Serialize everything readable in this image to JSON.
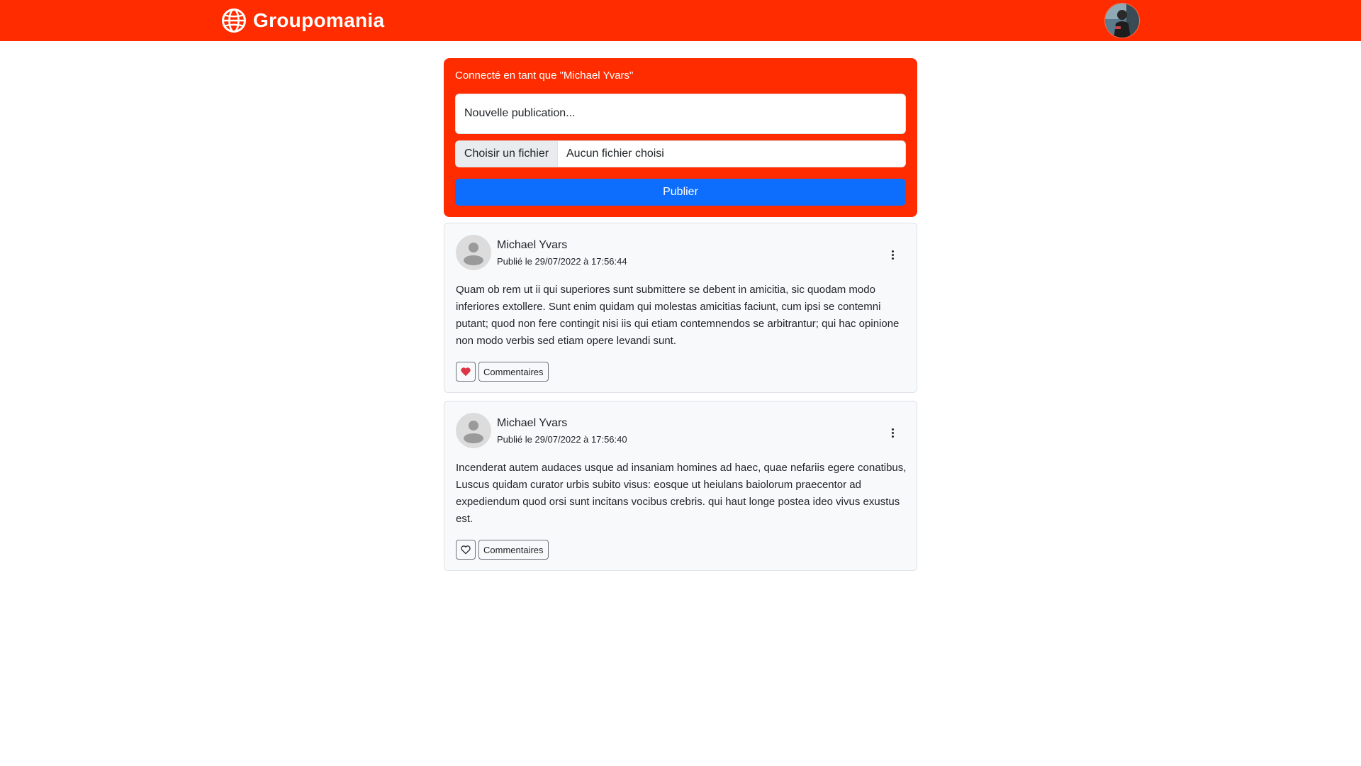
{
  "header": {
    "brand_name": "Groupomania",
    "brand_icon": "globe-icon",
    "color": "#ff2c00"
  },
  "composer": {
    "connected_label": "Connecté en tant que \"Michael Yvars\"",
    "textarea_placeholder": "Nouvelle publication...",
    "file_button_label": "Choisir un fichier",
    "file_status": "Aucun fichier choisi",
    "publish_label": "Publier",
    "publish_color": "#0d6efd"
  },
  "posts": [
    {
      "author": "Michael Yvars",
      "date": "Publié le 29/07/2022 à 17:56:44",
      "body": "Quam ob rem ut ii qui superiores sunt submittere se debent in amicitia, sic quodam modo inferiores extollere. Sunt enim quidam qui molestas amicitias faciunt, cum ipsi se contemni putant; quod non fere contingit nisi iis qui etiam contemnendos se arbitrantur; qui hac opinione non modo verbis sed etiam opere levandi sunt.",
      "liked": true,
      "like_icon": "heart-filled-icon",
      "comments_label": "Commentaires"
    },
    {
      "author": "Michael Yvars",
      "date": "Publié le 29/07/2022 à 17:56:40",
      "body": "Incenderat autem audaces usque ad insaniam homines ad haec, quae nefariis egere conatibus, Luscus quidam curator urbis subito visus: eosque ut heiulans baiolorum praecentor ad expediendum quod orsi sunt incitans vocibus crebris. qui haut longe postea ideo vivus exustus est.",
      "liked": false,
      "like_icon": "heart-outline-icon",
      "comments_label": "Commentaires"
    }
  ]
}
